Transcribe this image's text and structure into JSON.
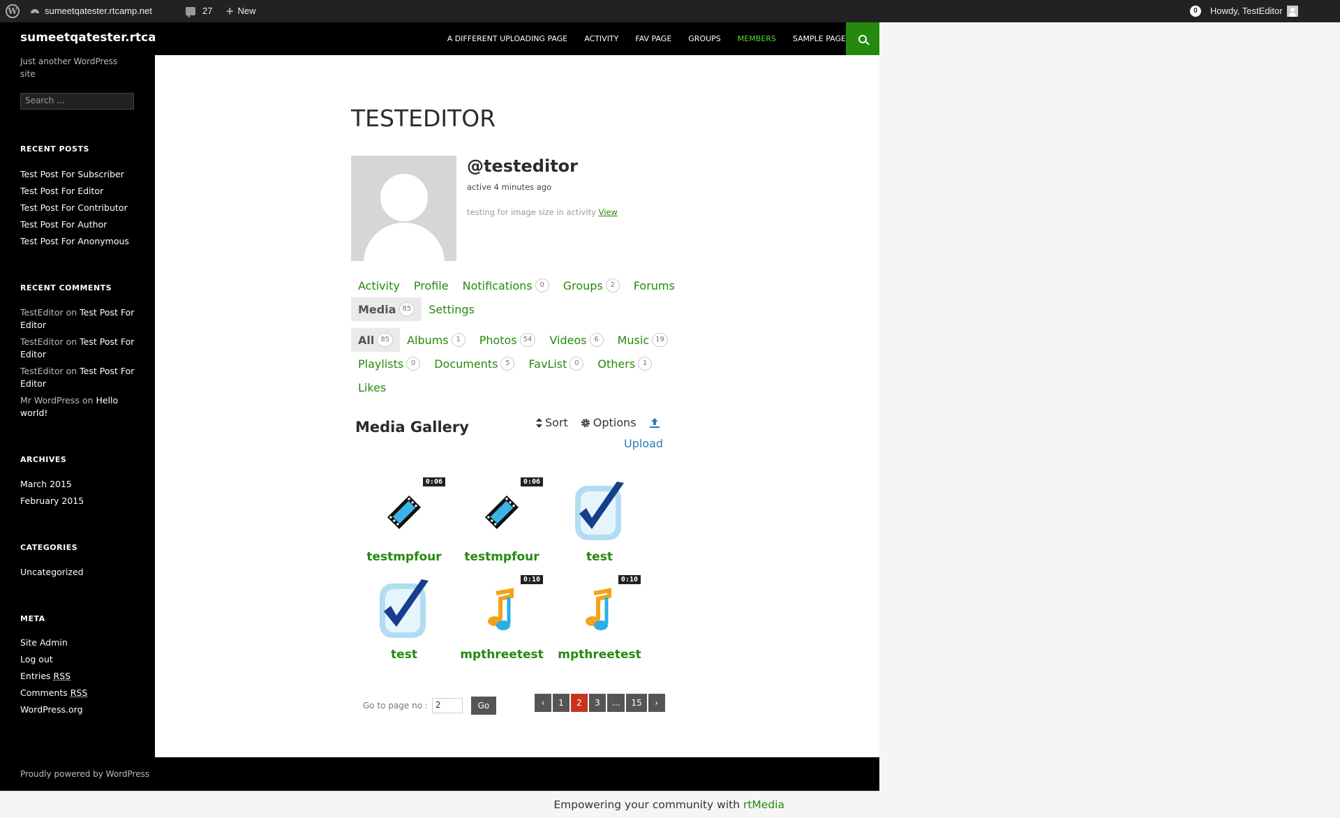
{
  "adminbar": {
    "site_name": "sumeetqatester.rtcamp.net",
    "comments_count": "27",
    "new_label": "New",
    "notifications": "0",
    "howdy": "Howdy, TestEditor"
  },
  "site": {
    "title": "sumeetqatester.rtcamp.net",
    "tagline": "Just another WordPress site",
    "search_placeholder": "Search ..."
  },
  "nav": [
    {
      "label": "A DIFFERENT UPLOADING PAGE"
    },
    {
      "label": "ACTIVITY"
    },
    {
      "label": "FAV PAGE"
    },
    {
      "label": "GROUPS"
    },
    {
      "label": "MEMBERS",
      "active": true
    },
    {
      "label": "SAMPLE PAGE"
    }
  ],
  "widgets": {
    "recent_posts": {
      "title": "RECENT POSTS",
      "items": [
        "Test Post For Subscriber",
        "Test Post For Editor",
        "Test Post For Contributor",
        "Test Post For Author",
        "Test Post For Anonymous"
      ]
    },
    "recent_comments": {
      "title": "RECENT COMMENTS",
      "on_word": "on",
      "items": [
        {
          "author": "TestEditor",
          "post": "Test Post For Editor"
        },
        {
          "author": "TestEditor",
          "post": "Test Post For Editor"
        },
        {
          "author": "TestEditor",
          "post": "Test Post For Editor"
        },
        {
          "author": "Mr WordPress",
          "post": "Hello world!"
        }
      ]
    },
    "archives": {
      "title": "ARCHIVES",
      "items": [
        "March 2015",
        "February 2015"
      ]
    },
    "categories": {
      "title": "CATEGORIES",
      "items": [
        "Uncategorized"
      ]
    },
    "meta": {
      "title": "META",
      "site_admin": "Site Admin",
      "log_out": "Log out",
      "entries": "Entries",
      "comments": "Comments",
      "rss": "RSS",
      "wordpress_org": "WordPress.org"
    }
  },
  "profile": {
    "page_title": "TESTEDITOR",
    "handle": "@testeditor",
    "active": "active 4 minutes ago",
    "latest_update": "testing for image size in activity",
    "view_label": "View"
  },
  "profile_tabs": [
    {
      "label": "Activity"
    },
    {
      "label": "Profile"
    },
    {
      "label": "Notifications",
      "count": "0"
    },
    {
      "label": "Groups",
      "count": "2"
    },
    {
      "label": "Forums"
    },
    {
      "label": "Media",
      "count": "85",
      "current": true
    },
    {
      "label": "Settings"
    }
  ],
  "media_tabs": [
    {
      "label": "All",
      "count": "85",
      "current": true
    },
    {
      "label": "Albums",
      "count": "1"
    },
    {
      "label": "Photos",
      "count": "54"
    },
    {
      "label": "Videos",
      "count": "6"
    },
    {
      "label": "Music",
      "count": "19"
    },
    {
      "label": "Playlists",
      "count": "0"
    },
    {
      "label": "Documents",
      "count": "5"
    },
    {
      "label": "FavList",
      "count": "0"
    },
    {
      "label": "Others",
      "count": "1"
    },
    {
      "label": "Likes"
    }
  ],
  "gallery": {
    "title": "Media Gallery",
    "sort": "Sort",
    "options": "Options",
    "upload": "Upload",
    "items": [
      {
        "title": "testmpfour",
        "type": "video",
        "duration": "0:06"
      },
      {
        "title": "testmpfour",
        "type": "video",
        "duration": "0:06"
      },
      {
        "title": "test",
        "type": "check"
      },
      {
        "title": "test",
        "type": "check"
      },
      {
        "title": "mpthreetest",
        "type": "audio",
        "duration": "0:10"
      },
      {
        "title": "mpthreetest",
        "type": "audio",
        "duration": "0:10"
      }
    ]
  },
  "pagination": {
    "goto_label": "Go to page no :",
    "page_value": "2",
    "go": "Go",
    "prev": "‹",
    "next": "›",
    "pages": [
      "1",
      "2",
      "3",
      "...",
      "15"
    ],
    "current": "2"
  },
  "footer": {
    "powered": "Proudly powered by WordPress",
    "empower_text": "Empowering your community with",
    "empower_brand": "rtMedia"
  },
  "colors": {
    "accent_green": "#24890d",
    "nav_active": "#55d737",
    "pager_current": "#c8331d"
  }
}
